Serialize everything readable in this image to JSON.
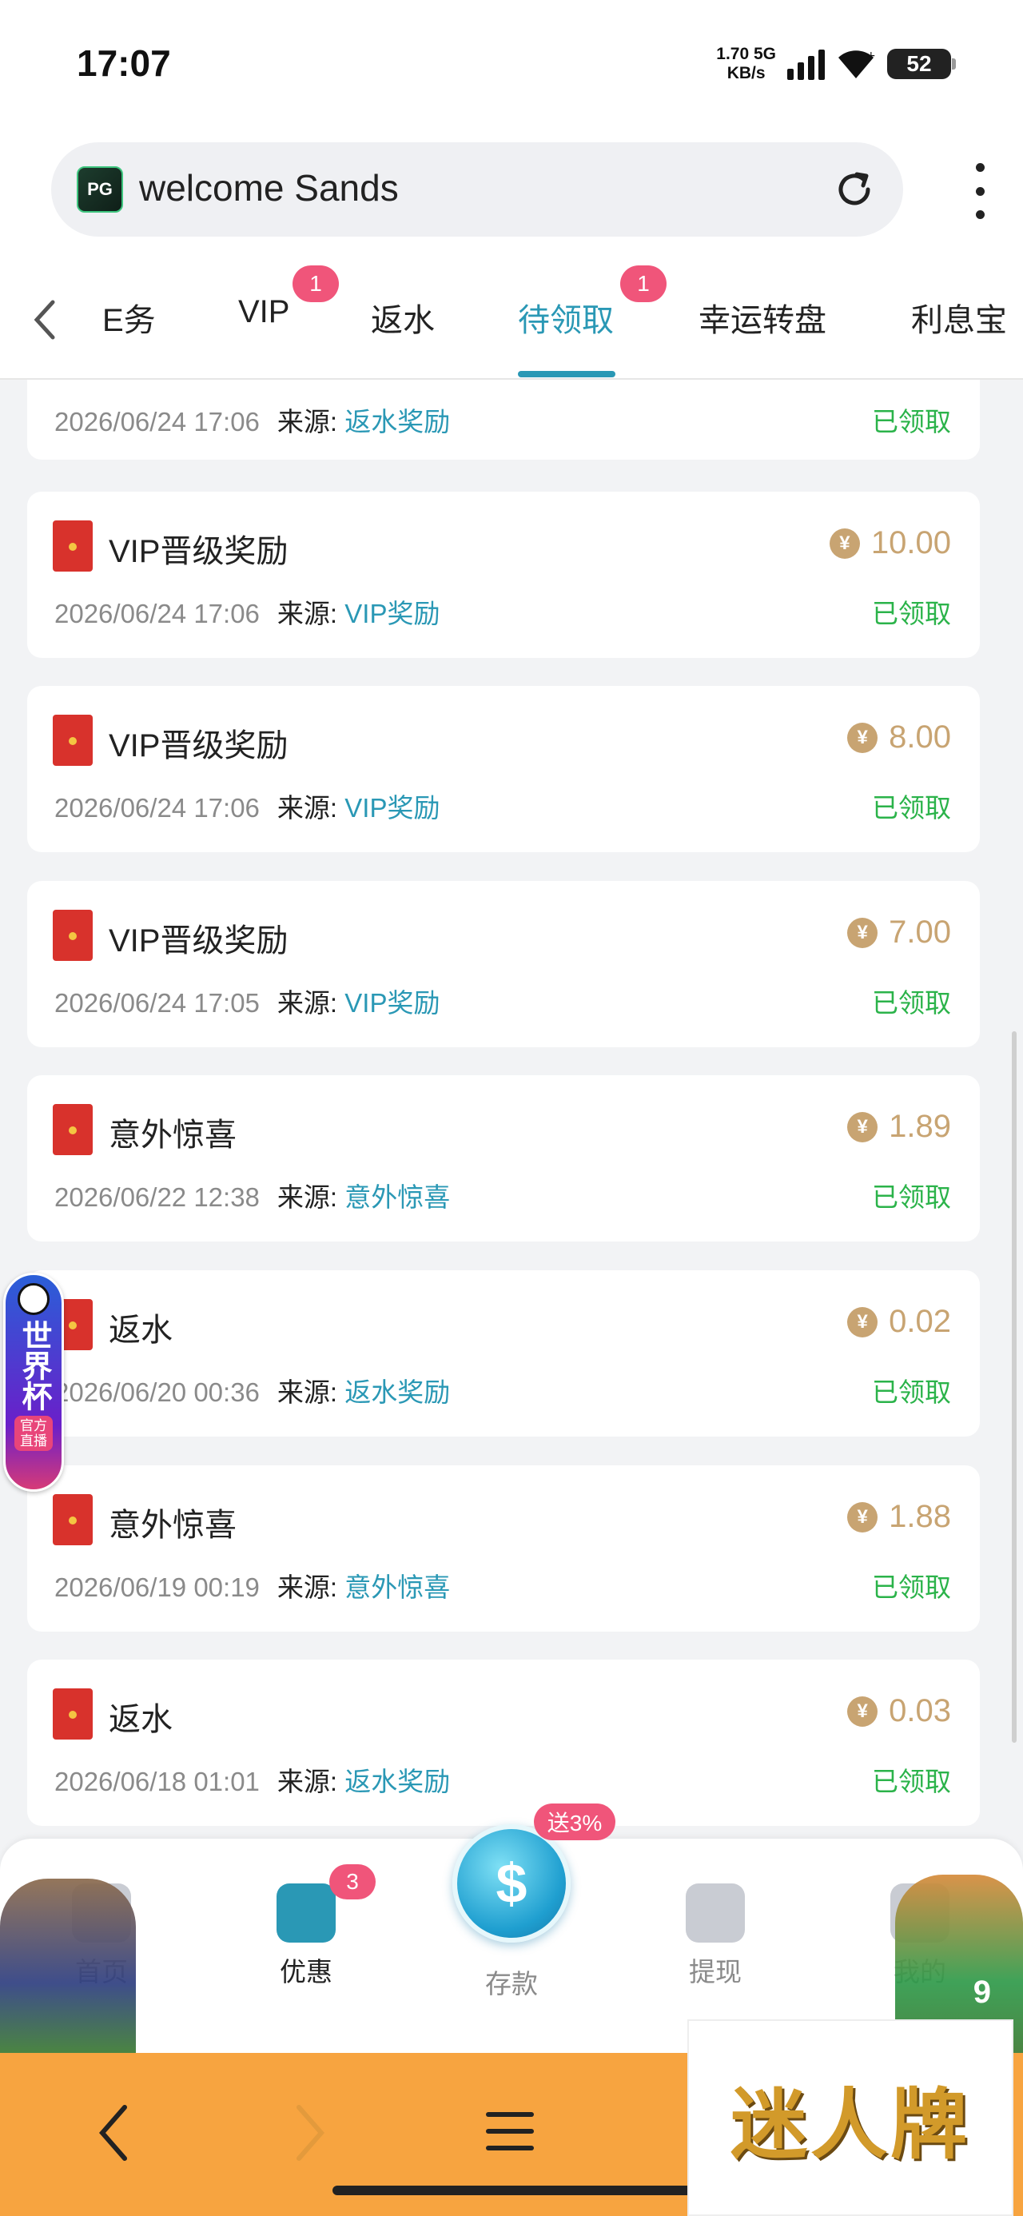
{
  "status_bar": {
    "time": "17:07",
    "net_speed_value": "1.70",
    "net_speed_unit": "KB/s",
    "network": "5G",
    "battery": "52"
  },
  "browser": {
    "address_text": "welcome Sands",
    "site_logo": "PG"
  },
  "tabs": {
    "items": [
      {
        "label": "任务",
        "shown": "E务"
      },
      {
        "label": "VIP",
        "badge": "1"
      },
      {
        "label": "返水"
      },
      {
        "label": "待领取",
        "badge": "1",
        "active": true
      },
      {
        "label": "幸运转盘"
      },
      {
        "label": "利息宝"
      }
    ]
  },
  "records": [
    {
      "title": "",
      "amount": "",
      "date": "2026/06/24 17:06",
      "source_label": "来源:",
      "source": "返水奖励",
      "status": "已领取"
    },
    {
      "title": "VIP晋级奖励",
      "amount": "10.00",
      "date": "2026/06/24 17:06",
      "source_label": "来源:",
      "source": "VIP奖励",
      "status": "已领取"
    },
    {
      "title": "VIP晋级奖励",
      "amount": "8.00",
      "date": "2026/06/24 17:06",
      "source_label": "来源:",
      "source": "VIP奖励",
      "status": "已领取"
    },
    {
      "title": "VIP晋级奖励",
      "amount": "7.00",
      "date": "2026/06/24 17:05",
      "source_label": "来源:",
      "source": "VIP奖励",
      "status": "已领取"
    },
    {
      "title": "意外惊喜",
      "amount": "1.89",
      "date": "2026/06/22 12:38",
      "source_label": "来源:",
      "source": "意外惊喜",
      "status": "已领取"
    },
    {
      "title": "返水",
      "amount": "0.02",
      "date": "2026/06/20 00:36",
      "source_label": "来源:",
      "source": "返水奖励",
      "status": "已领取"
    },
    {
      "title": "意外惊喜",
      "amount": "1.88",
      "date": "2026/06/19 00:19",
      "source_label": "来源:",
      "source": "意外惊喜",
      "status": "已领取"
    },
    {
      "title": "返水",
      "amount": "0.03",
      "date": "2026/06/18 01:01",
      "source_label": "来源:",
      "source": "返水奖励",
      "status": "已领取"
    }
  ],
  "coin_symbol": "¥",
  "world_cup_badge": {
    "title": "世界杯",
    "sub": "官方直播"
  },
  "bottom_nav": {
    "home": "首页",
    "promo": "优惠",
    "promo_badge": "3",
    "deposit": "存款",
    "deposit_tag": "送3%",
    "withdraw": "提现",
    "mine": "我的"
  },
  "mascot_number": "9",
  "watermark": "迷人牌",
  "colors": {
    "accent": "#2a98b5",
    "badge": "#f0557a",
    "amount": "#c8a472",
    "claimed": "#2bb34a",
    "system_nav": "#f7a440"
  }
}
